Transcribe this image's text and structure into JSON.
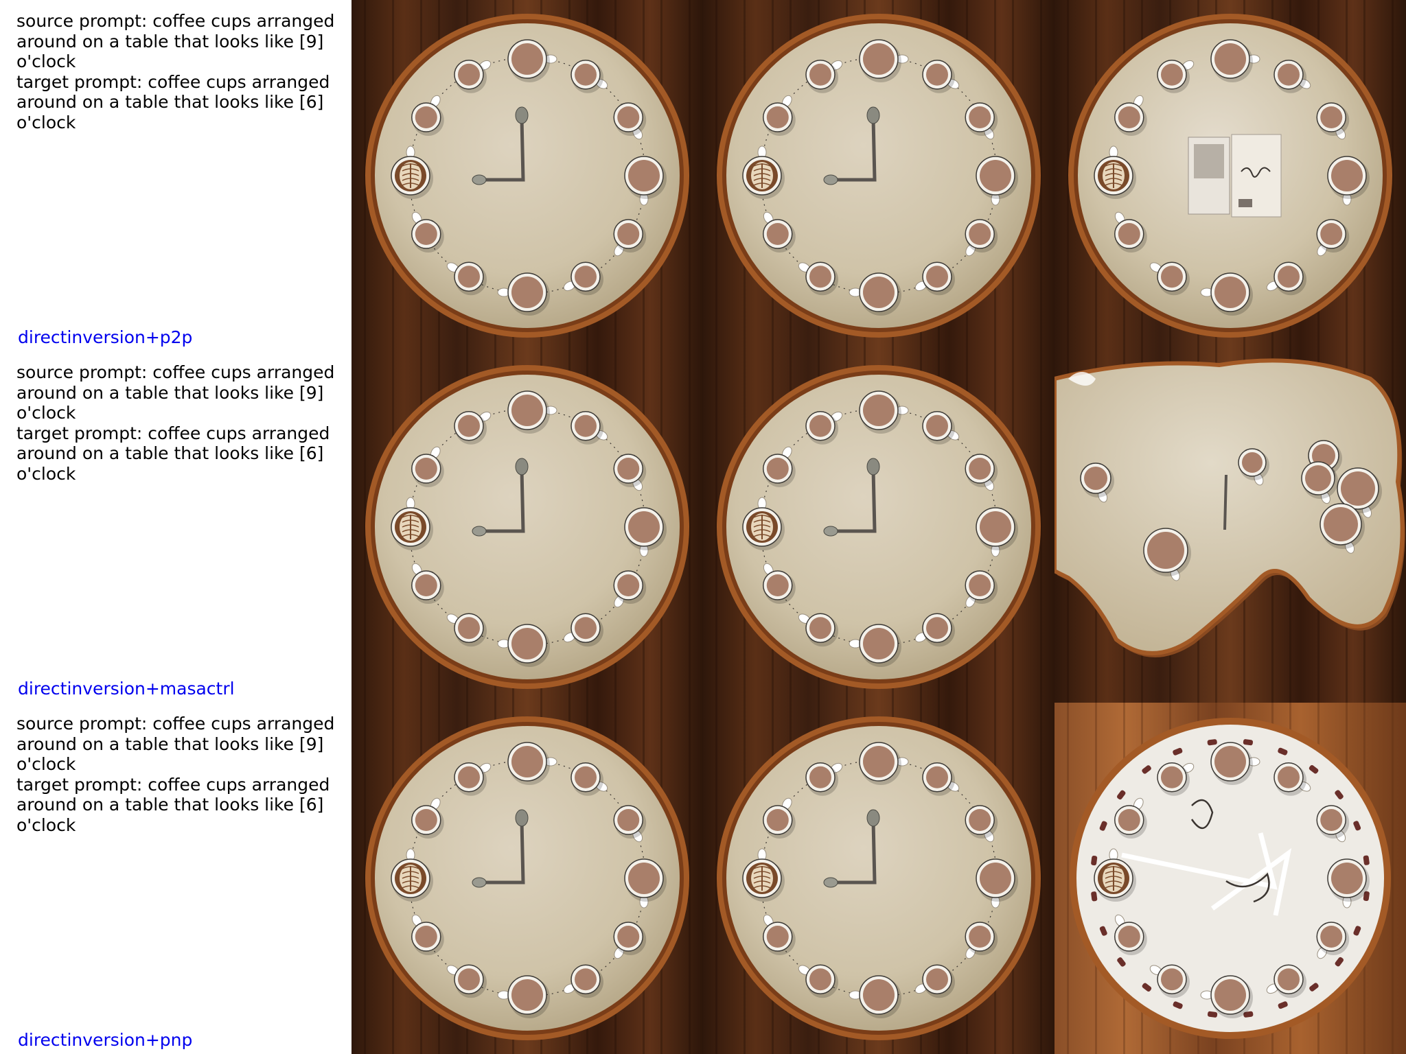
{
  "rows": [
    {
      "source_prompt": "source prompt: coffee cups arranged around on a table that looks like [9] o'clock",
      "target_prompt": "target prompt: coffee cups arranged around on a table that looks like [6] o'clock",
      "method": "directinversion+p2p",
      "images": [
        {
          "name": "source-image",
          "variant": "clock-nine"
        },
        {
          "name": "reconstruction-image",
          "variant": "clock-nine"
        },
        {
          "name": "edited-image",
          "variant": "clock-photos"
        }
      ]
    },
    {
      "source_prompt": "source prompt: coffee cups arranged around on a table that looks like [9] o'clock",
      "target_prompt": "target prompt: coffee cups arranged around on a table that looks like [6] o'clock",
      "method": "directinversion+masactrl",
      "images": [
        {
          "name": "source-image",
          "variant": "clock-nine"
        },
        {
          "name": "reconstruction-image",
          "variant": "clock-nine"
        },
        {
          "name": "edited-image",
          "variant": "distorted-table"
        }
      ]
    },
    {
      "source_prompt": "source prompt: coffee cups arranged around on a table that looks like [9] o'clock",
      "target_prompt": "target prompt: coffee cups arranged around on a table that looks like [6] o'clock",
      "method": "directinversion+pnp",
      "images": [
        {
          "name": "source-image",
          "variant": "clock-nine"
        },
        {
          "name": "reconstruction-image",
          "variant": "clock-nine"
        },
        {
          "name": "edited-image",
          "variant": "white-clock-face"
        }
      ]
    }
  ],
  "colors": {
    "method_label": "#0000ee",
    "wood_dark": "#3a1e10",
    "wood_mid": "#6b3a1c",
    "table_top": "#d6cbb6",
    "table_rim": "#a35a26",
    "cup_coffee": "#a97f6a",
    "cup_rim": "#f4f1ea"
  }
}
